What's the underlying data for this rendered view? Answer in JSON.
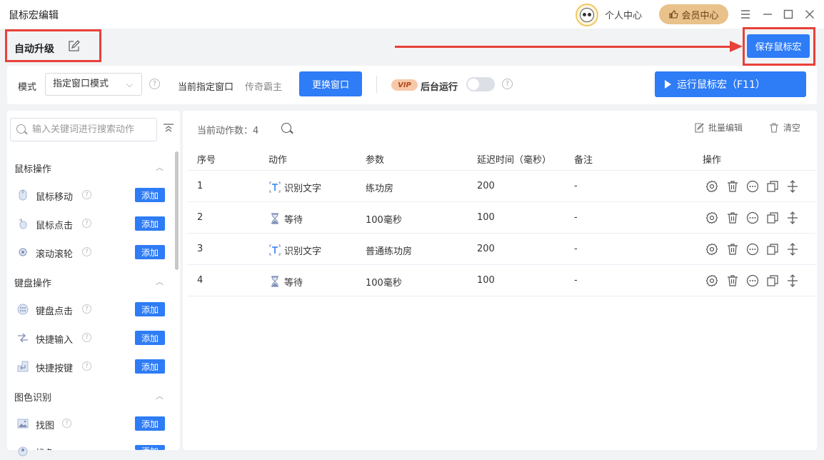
{
  "titlebar": {
    "title": "鼠标宏编辑",
    "personal_center": "个人中心",
    "vip_center": "会员中心"
  },
  "macro": {
    "name": "自动升级",
    "save_label": "保存鼠标宏"
  },
  "toolbar": {
    "mode_label": "模式",
    "mode_value": "指定窗口模式",
    "current_window_label": "当前指定窗口",
    "current_window_value": "传奇霸主",
    "change_window_label": "更换窗口",
    "vip_badge": "VIP",
    "background_run_label": "后台运行",
    "background_run_enabled": false,
    "run_label": "运行鼠标宏（F11）"
  },
  "sidebar": {
    "search_placeholder": "输入关键词进行搜索动作",
    "add_label": "添加",
    "categories": [
      {
        "name": "鼠标操作",
        "items": [
          {
            "label": "鼠标移动",
            "icon": "mouse-icon"
          },
          {
            "label": "鼠标点击",
            "icon": "mouse-click-icon"
          },
          {
            "label": "滚动滚轮",
            "icon": "wheel-icon"
          }
        ]
      },
      {
        "name": "键盘操作",
        "items": [
          {
            "label": "键盘点击",
            "icon": "keyboard-icon"
          },
          {
            "label": "快捷输入",
            "icon": "quick-input-icon"
          },
          {
            "label": "快捷按键",
            "icon": "enter-key-icon"
          }
        ]
      },
      {
        "name": "图色识别",
        "items": [
          {
            "label": "找图",
            "icon": "image-icon"
          },
          {
            "label": "找色",
            "icon": "color-picker-icon"
          }
        ]
      }
    ]
  },
  "main": {
    "count_label": "当前动作数：",
    "count_value": "4",
    "bulk_edit_label": "批量编辑",
    "clear_label": "清空",
    "headers": [
      "序号",
      "动作",
      "参数",
      "延迟时间（毫秒）",
      "备注",
      "操作"
    ],
    "rows": [
      {
        "index": "1",
        "action": "识别文字",
        "action_icon": "text-recognize-icon",
        "param": "练功房",
        "delay": "200",
        "note": "-"
      },
      {
        "index": "2",
        "action": "等待",
        "action_icon": "hourglass-icon",
        "param": "100毫秒",
        "delay": "100",
        "note": "-"
      },
      {
        "index": "3",
        "action": "识别文字",
        "action_icon": "text-recognize-icon",
        "param": "普通练功房",
        "delay": "200",
        "note": "-"
      },
      {
        "index": "4",
        "action": "等待",
        "action_icon": "hourglass-icon",
        "param": "100毫秒",
        "delay": "100",
        "note": "-"
      }
    ]
  },
  "colors": {
    "primary": "#2e7cf6",
    "annotation_red": "#e8413a",
    "vip_gold": "#e9c18a"
  }
}
